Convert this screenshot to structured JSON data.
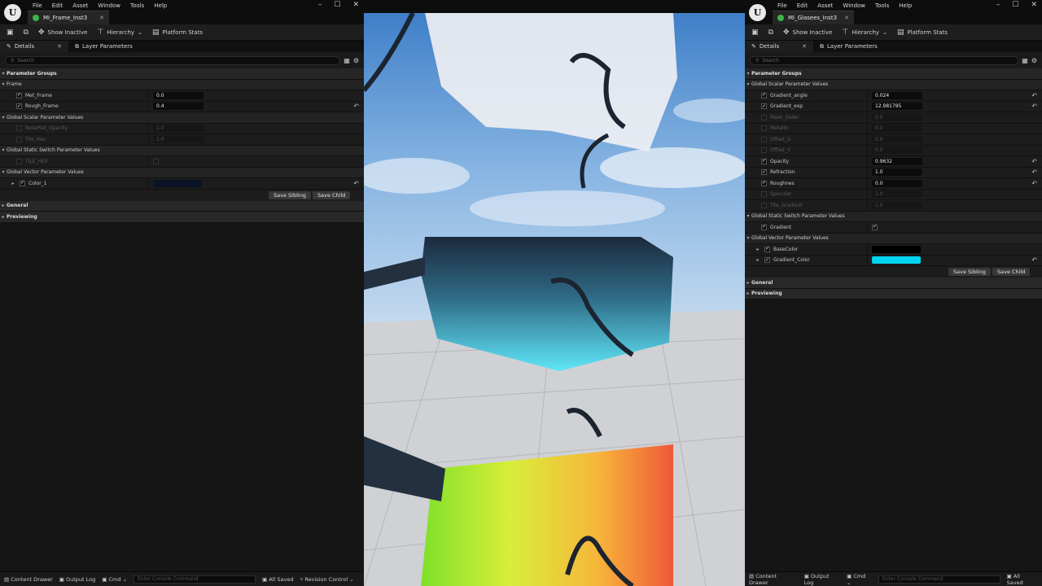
{
  "menu": [
    "File",
    "Edit",
    "Asset",
    "Window",
    "Tools",
    "Help"
  ],
  "logo": "U",
  "toolbar": {
    "save_icon": "save-icon",
    "browse_icon": "browse-icon",
    "show_inactive": "Show Inactive",
    "hierarchy": "Hierarchy",
    "platform_stats": "Platform Stats"
  },
  "panel_tabs": {
    "details": "Details",
    "layer_parameters": "Layer Parameters"
  },
  "search_placeholder": "Search",
  "left": {
    "title": "MI_Frame_Inst3",
    "param_groups": "Parameter Groups",
    "frame_group": "Frame",
    "met_frame": {
      "label": "Met_Frame",
      "value": "0.0"
    },
    "rough_frame": {
      "label": "Rough_Frame",
      "value": "0.4"
    },
    "scalar_group": "Global Scalar Parameter Values",
    "nosepad": {
      "label": "NosePad_Opacity",
      "value": "1.0"
    },
    "tile_hex": {
      "label": "Tile_Hex",
      "value": "1.0"
    },
    "switch_group": "Global Static Switch Parameter Values",
    "tile_hex_switch": "TILE_HEX",
    "vector_group": "Global Vector Parameter Values",
    "color1": {
      "label": "Color_1",
      "color": "#0b1326"
    },
    "save_sibling": "Save Sibling",
    "save_child": "Save Child",
    "general": "General",
    "previewing": "Previewing"
  },
  "right": {
    "title": "MI_Glasees_Inst3",
    "param_groups": "Parameter Groups",
    "scalar_group": "Global Scalar Parameter Values",
    "scalars": [
      {
        "label": "Gradient_angle",
        "value": "0.024",
        "enabled": true
      },
      {
        "label": "Gradient_exp",
        "value": "12.981795",
        "enabled": true
      },
      {
        "label": "Mask_Slider",
        "value": "0.0",
        "enabled": false
      },
      {
        "label": "Metallic",
        "value": "0.0",
        "enabled": false
      },
      {
        "label": "Offset_U",
        "value": "0.0",
        "enabled": false
      },
      {
        "label": "Offset_V",
        "value": "0.0",
        "enabled": false
      },
      {
        "label": "Opacity",
        "value": "0.9632",
        "enabled": true
      },
      {
        "label": "Refraction",
        "value": "1.0",
        "enabled": true
      },
      {
        "label": "Roughnes",
        "value": "0.0",
        "enabled": true
      },
      {
        "label": "Specular",
        "value": "1.0",
        "enabled": false
      },
      {
        "label": "Tile_Gradient",
        "value": "1.0",
        "enabled": false
      }
    ],
    "switch_group": "Global Static Switch Parameter Values",
    "gradient_switch": "Gradient",
    "vector_group": "Global Vector Parameter Values",
    "basecolor": {
      "label": "BaseColor",
      "color": "#000000"
    },
    "gradient_color": {
      "label": "Gradient_Color",
      "color": "#00d4f0"
    },
    "save_sibling": "Save Sibling",
    "save_child": "Save Child",
    "general": "General",
    "previewing": "Previewing"
  },
  "statusbar": {
    "content_drawer": "Content Drawer",
    "output_log": "Output Log",
    "cmd": "Cmd",
    "console_placeholder": "Enter Console Command",
    "all_saved": "All Saved",
    "revision_control": "Revision Control"
  }
}
